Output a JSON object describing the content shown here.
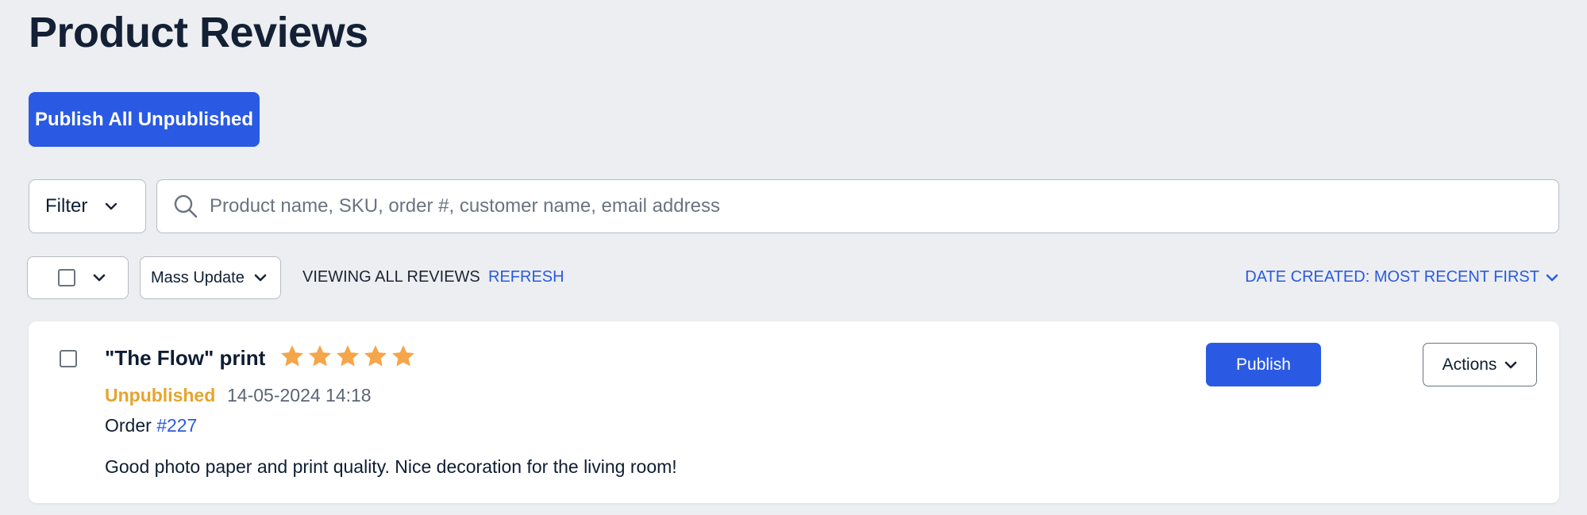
{
  "page": {
    "title": "Product Reviews"
  },
  "toolbar": {
    "publish_all_label": "Publish All Unpublished"
  },
  "filter": {
    "label": "Filter"
  },
  "search": {
    "placeholder": "Product name, SKU, order #, customer name, email address",
    "value": ""
  },
  "bulk": {
    "mass_update_label": "Mass Update",
    "viewing_label": "VIEWING ALL REVIEWS",
    "refresh_label": "REFRESH",
    "sort_label": "DATE CREATED: MOST RECENT FIRST"
  },
  "reviews": [
    {
      "product": "\"The Flow\" print",
      "rating": 5,
      "rating_max": 5,
      "status": "Unpublished",
      "date": "14-05-2024 14:18",
      "order_prefix": "Order",
      "order_number": "#227",
      "text": "Good photo paper and print quality. Nice decoration for the living room!",
      "publish_label": "Publish",
      "actions_label": "Actions"
    }
  ],
  "colors": {
    "accent": "#2a5ae3",
    "star": "#f5a54a",
    "unpublished": "#e7a42b",
    "background": "#eceef1"
  },
  "icons": {
    "search": "search-icon",
    "chevron": "chevron-down-icon",
    "star": "star-icon"
  }
}
